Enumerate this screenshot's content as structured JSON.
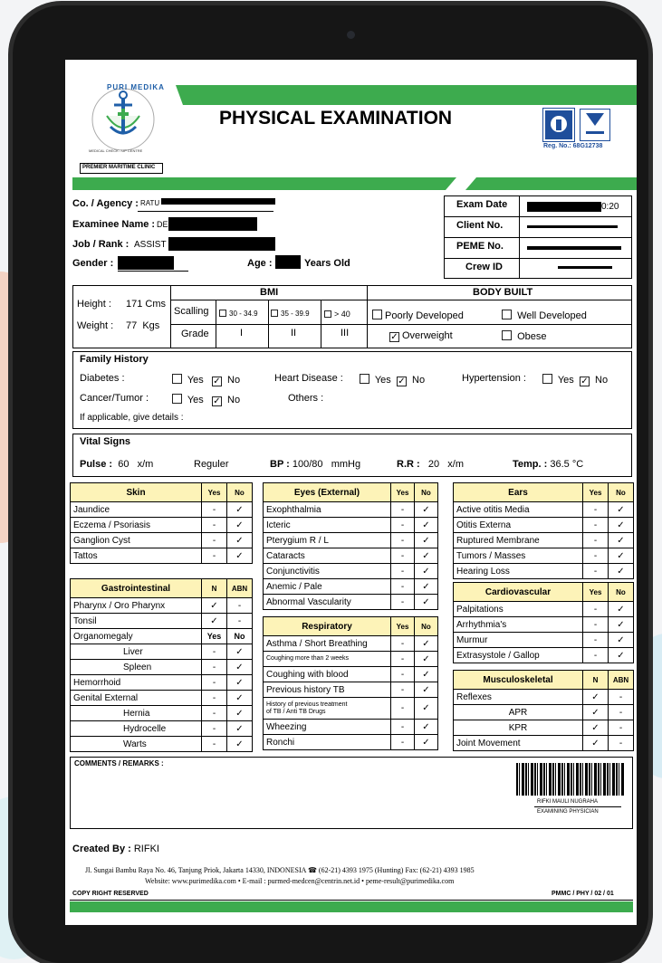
{
  "header": {
    "title": "PHYSICAL EXAMINATION",
    "logo_text": "PURI MEDIKA",
    "logo_sub": "MEDICAL CHECK - UP CENTRE",
    "clinic": "PREMIER MARITIME CLINIC",
    "reg_no": "Reg. No.: 68G12738"
  },
  "info": {
    "agency_label": "Co. / Agency :",
    "agency_value": "RATU",
    "examinee_label": "Examinee Name :",
    "examinee_value": "DE",
    "job_label": "Job / Rank :",
    "job_value": "ASSIST",
    "gender_label": "Gender :",
    "age_label": "Age :",
    "age_suffix": "Years Old",
    "exam_date_label": "Exam Date",
    "exam_date_value": "0:20",
    "client_no_label": "Client No.",
    "peme_no_label": "PEME No.",
    "crew_id_label": "Crew ID"
  },
  "measure": {
    "height_label": "Height :",
    "height_value": "171 Cms",
    "weight_label": "Weight :",
    "weight_value": "77  Kgs",
    "bmi_title": "BMI",
    "scalling_label": "Scalling",
    "grade_label": "Grade",
    "scales": [
      "30 - 34.9",
      "35 - 39.9",
      "> 40"
    ],
    "grades": [
      "I",
      "II",
      "III"
    ],
    "body_built_title": "BODY BUILT",
    "body_options": [
      {
        "label": "Poorly Developed",
        "checked": false
      },
      {
        "label": "Well Developed",
        "checked": false
      },
      {
        "label": "Overweight",
        "checked": true
      },
      {
        "label": "Obese",
        "checked": false
      }
    ]
  },
  "family": {
    "title": "Family History",
    "diabetes": "Diabetes :",
    "heart": "Heart Disease :",
    "hypertension": "Hypertension :",
    "cancer": "Cancer/Tumor :",
    "others": "Others :",
    "details": "If applicable, give details :",
    "yes": "Yes",
    "no": "No"
  },
  "vitals": {
    "title": "Vital Signs",
    "pulse_label": "Pulse :",
    "pulse_value": "60",
    "pulse_unit": "x/m",
    "pulse_rhythm": "Reguler",
    "bp_label": "BP :",
    "bp_value": "100/80",
    "bp_unit": "mmHg",
    "rr_label": "R.R :",
    "rr_value": "20",
    "rr_unit": "x/m",
    "temp_label": "Temp. :",
    "temp_value": "36.5",
    "temp_unit": "°C"
  },
  "skin": {
    "title": "Skin",
    "h1": "Yes",
    "h2": "No",
    "rows": [
      [
        "Jaundice",
        "-",
        "✓"
      ],
      [
        "Eczema / Psoriasis",
        "-",
        "✓"
      ],
      [
        "Ganglion Cyst",
        "-",
        "✓"
      ],
      [
        "Tattos",
        "-",
        "✓"
      ]
    ]
  },
  "gastro": {
    "title": "Gastrointestinal",
    "h1": "N",
    "h2": "ABN",
    "rows": [
      [
        "Pharynx / Oro Pharynx",
        "✓",
        "-"
      ],
      [
        "Tonsil",
        "✓",
        "-"
      ]
    ],
    "organ_label": "Organomegaly",
    "organ_h1": "Yes",
    "organ_h2": "No",
    "organ_rows": [
      [
        "Liver",
        "-",
        "✓"
      ],
      [
        "Spleen",
        "-",
        "✓"
      ]
    ],
    "rows2": [
      [
        "Hemorrhoid",
        "-",
        "✓"
      ],
      [
        "Genital External",
        "-",
        "✓"
      ]
    ],
    "sub_rows": [
      [
        "Hernia",
        "-",
        "✓"
      ],
      [
        "Hydrocelle",
        "-",
        "✓"
      ],
      [
        "Warts",
        "-",
        "✓"
      ]
    ]
  },
  "eyes": {
    "title": "Eyes (External)",
    "h1": "Yes",
    "h2": "No",
    "rows": [
      [
        "Exophthalmia",
        "-",
        "✓"
      ],
      [
        "Icteric",
        "-",
        "✓"
      ],
      [
        "Pterygium R / L",
        "-",
        "✓"
      ],
      [
        "Cataracts",
        "-",
        "✓"
      ],
      [
        "Conjunctivitis",
        "-",
        "✓"
      ],
      [
        "Anemic / Pale",
        "-",
        "✓"
      ],
      [
        "Abnormal Vascularity",
        "-",
        "✓"
      ]
    ]
  },
  "resp": {
    "title": "Respiratory",
    "h1": "Yes",
    "h2": "No",
    "r1": [
      "Asthma / Short Breathing",
      "-",
      "✓"
    ],
    "r2": [
      "Coughing more than 2 weeks",
      "-",
      "✓"
    ],
    "r3": [
      "Coughing with blood",
      "-",
      "✓"
    ],
    "r4": [
      "Previous history TB",
      "-",
      "✓"
    ],
    "r5a": "History of previous treatment",
    "r5b": "of TB / Anti TB Drugs",
    "r5y": "-",
    "r5n": "✓",
    "r6": [
      "Wheezing",
      "-",
      "✓"
    ],
    "r7": [
      "Ronchi",
      "-",
      "✓"
    ]
  },
  "ears": {
    "title": "Ears",
    "h1": "Yes",
    "h2": "No",
    "rows": [
      [
        "Active otitis Media",
        "-",
        "✓"
      ],
      [
        "Otitis Externa",
        "-",
        "✓"
      ],
      [
        "Ruptured Membrane",
        "-",
        "✓"
      ],
      [
        "Tumors / Masses",
        "-",
        "✓"
      ],
      [
        "Hearing Loss",
        "-",
        "✓"
      ]
    ]
  },
  "cardio": {
    "title": "Cardiovascular",
    "h1": "Yes",
    "h2": "No",
    "rows": [
      [
        "Palpitations",
        "-",
        "✓"
      ],
      [
        "Arrhythmia's",
        "-",
        "✓"
      ],
      [
        "Murmur",
        "-",
        "✓"
      ],
      [
        "Extrasystole / Gallop",
        "-",
        "✓"
      ]
    ]
  },
  "musculo": {
    "title": "Musculoskeletal",
    "h1": "N",
    "h2": "ABN",
    "rows": [
      [
        "Reflexes",
        "✓",
        "-"
      ]
    ],
    "sub_rows": [
      [
        "APR",
        "✓",
        "-"
      ],
      [
        "KPR",
        "✓",
        "-"
      ]
    ],
    "rows2": [
      [
        "Joint Movement",
        "✓",
        "-"
      ]
    ]
  },
  "comments": {
    "label": "COMMENTS / REMARKS :",
    "physician": "RIFKI MAULI NUGRAHA",
    "physician_role": "EXAMINING PHYSICIAN"
  },
  "footer": {
    "created_label": "Created By :",
    "created_value": "RIFKI",
    "address": "Jl. Sungai Bambu Raya No. 46, Tanjung Priok, Jakarta 14330, INDONESIA ☎ (62-21) 4393 1975 (Hunting) Fax: (62-21) 4393 1985",
    "web": "Website: www.purimedika.com • E-mail : purmed-medcen@centrin.net.id • peme-result@purimedika.com",
    "copyright": "COPY RIGHT RESERVED",
    "code": "PMMC / PHY / 02 / 01"
  },
  "colors": {
    "green": "#3dab4e",
    "header_yellow": "#fdf3b8",
    "anchor_blue": "#1f5fa8"
  }
}
